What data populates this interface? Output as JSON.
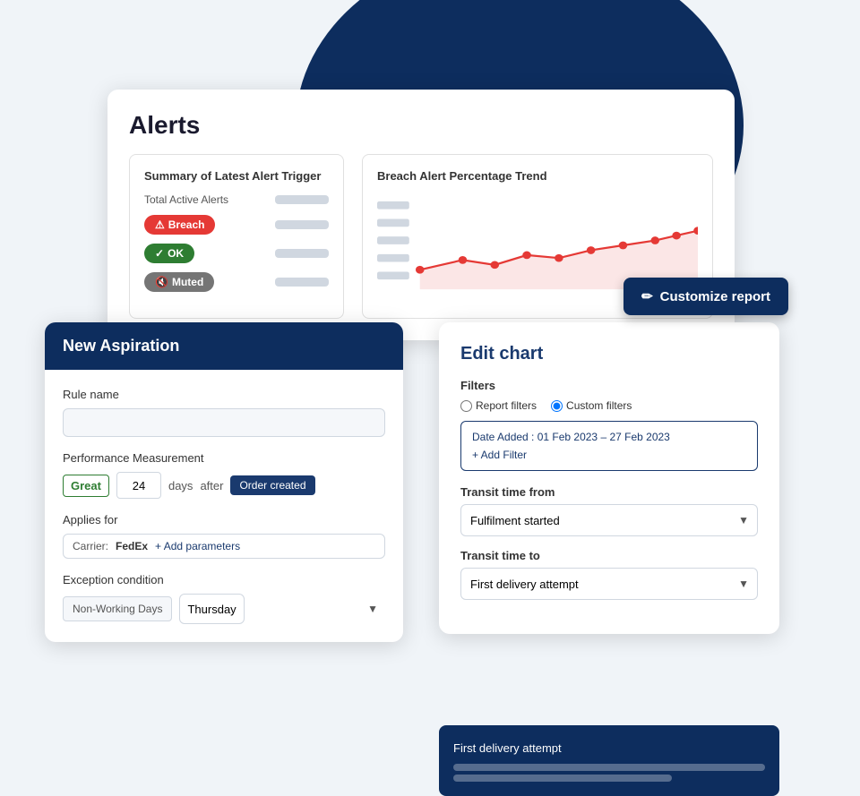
{
  "background": {
    "circle_color": "#0d2d5e"
  },
  "alerts_card": {
    "title": "Alerts",
    "summary": {
      "title": "Summary of Latest Alert Trigger",
      "total_label": "Total Active Alerts",
      "breach_label": "Breach",
      "ok_label": "OK",
      "muted_label": "Muted"
    },
    "trend": {
      "title": "Breach Alert Percentage Trend"
    }
  },
  "customize_btn": {
    "label": "Customize report",
    "icon": "✏"
  },
  "aspiration_card": {
    "header": "New Aspiration",
    "rule_name_label": "Rule name",
    "rule_name_placeholder": "",
    "perf_label": "Performance Measurement",
    "perf_great": "Great",
    "perf_days": "24",
    "perf_after": "days",
    "perf_after2": "after",
    "perf_order": "Order created",
    "applies_label": "Applies for",
    "applies_carrier": "Carrier:",
    "applies_fedex": "FedEx",
    "applies_add": "+ Add parameters",
    "exception_label": "Exception condition",
    "exception_type": "Non-Working Days",
    "exception_day": "Thursday"
  },
  "edit_chart_card": {
    "title": "Edit chart",
    "filters_label": "Filters",
    "radio_report": "Report filters",
    "radio_custom": "Custom filters",
    "date_label": "Date Added : 01 Feb 2023 – 27 Feb 2023",
    "add_filter": "+ Add Filter",
    "transit_from_label": "Transit time from",
    "transit_from_value": "Fulfilment started",
    "transit_to_label": "Transit time to",
    "transit_to_value": "First delivery attempt",
    "popup_item": "First delivery attempt"
  }
}
